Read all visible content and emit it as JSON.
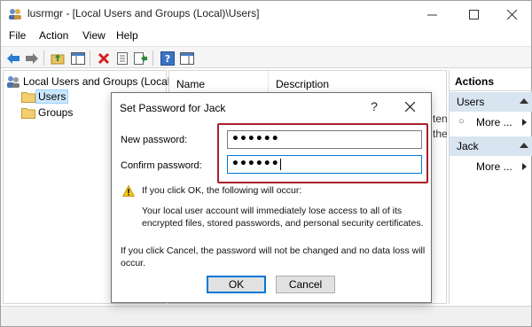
{
  "window": {
    "title": "lusrmgr - [Local Users and Groups (Local)\\Users]"
  },
  "menu": {
    "items": [
      "File",
      "Action",
      "View",
      "Help"
    ]
  },
  "toolbar": {
    "icons": [
      "back-arrow-icon",
      "forward-arrow-icon",
      "up-folder-icon",
      "show-hide-tree-icon",
      "delete-icon",
      "properties-icon",
      "export-list-icon",
      "help-icon",
      "show-hide-action-pane-icon"
    ]
  },
  "tree": {
    "root": "Local Users and Groups (Local)",
    "items": [
      "Users",
      "Groups"
    ]
  },
  "list": {
    "columns": [
      "Name",
      "Description"
    ],
    "partial_fragments": [
      "ten",
      "the"
    ]
  },
  "actions": {
    "title": "Actions",
    "sections": [
      {
        "label": "Users",
        "item": "More ..."
      },
      {
        "label": "Jack",
        "item": "More ..."
      }
    ]
  },
  "dialog": {
    "title": "Set Password for Jack",
    "help_label": "?",
    "new_password_label": "New password:",
    "new_password_value": "••••••",
    "confirm_password_label": "Confirm password:",
    "confirm_password_value": "••••••",
    "warning_heading": "If you click OK, the following will occur:",
    "warning_line1": "Your local user account will immediately lose access to all of its",
    "warning_line2": "encrypted files, stored passwords, and personal security certificates.",
    "cancel_note_line1": "If you click Cancel, the password will not be changed and no data loss will",
    "cancel_note_line2": "occur.",
    "ok_label": "OK",
    "cancel_label": "Cancel"
  },
  "colors": {
    "highlight_border": "#a8202a",
    "focus_blue": "#0078d7",
    "actions_section_bg": "#d9e4f1",
    "tree_selection": "#cce8ff"
  }
}
